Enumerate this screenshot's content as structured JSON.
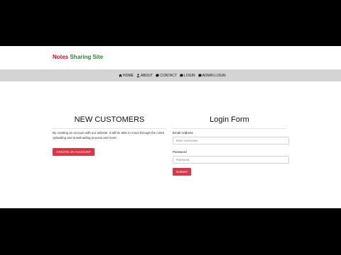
{
  "brand": {
    "word1": "Notes",
    "word2": "Sharing Site"
  },
  "nav": {
    "items": [
      {
        "label": "HOME",
        "icon": "home-icon"
      },
      {
        "label": "ABOUT",
        "icon": "user-icon"
      },
      {
        "label": "CONTACT",
        "icon": "contact-icon"
      },
      {
        "label": "LOGIN",
        "icon": "login-icon"
      },
      {
        "label": "ADMIN LOGIN",
        "icon": "admin-icon"
      }
    ]
  },
  "new_customers": {
    "title": "NEW CUSTOMERS",
    "description": "By creating an account with our website, it will be able to move through the notes uploading and downloading process and more.",
    "button": "CREATE AN ACCOUNT"
  },
  "login_form": {
    "title": "Login Form",
    "email_label": "Email Address",
    "email_placeholder": "Enter Username",
    "password_label": "Password",
    "password_placeholder": "Password",
    "submit": "SUBMIT"
  },
  "colors": {
    "brand_red": "#c8102e",
    "brand_green": "#2e7d32",
    "navbar_bg": "#d4d4d4",
    "button_red": "#dc3545"
  }
}
